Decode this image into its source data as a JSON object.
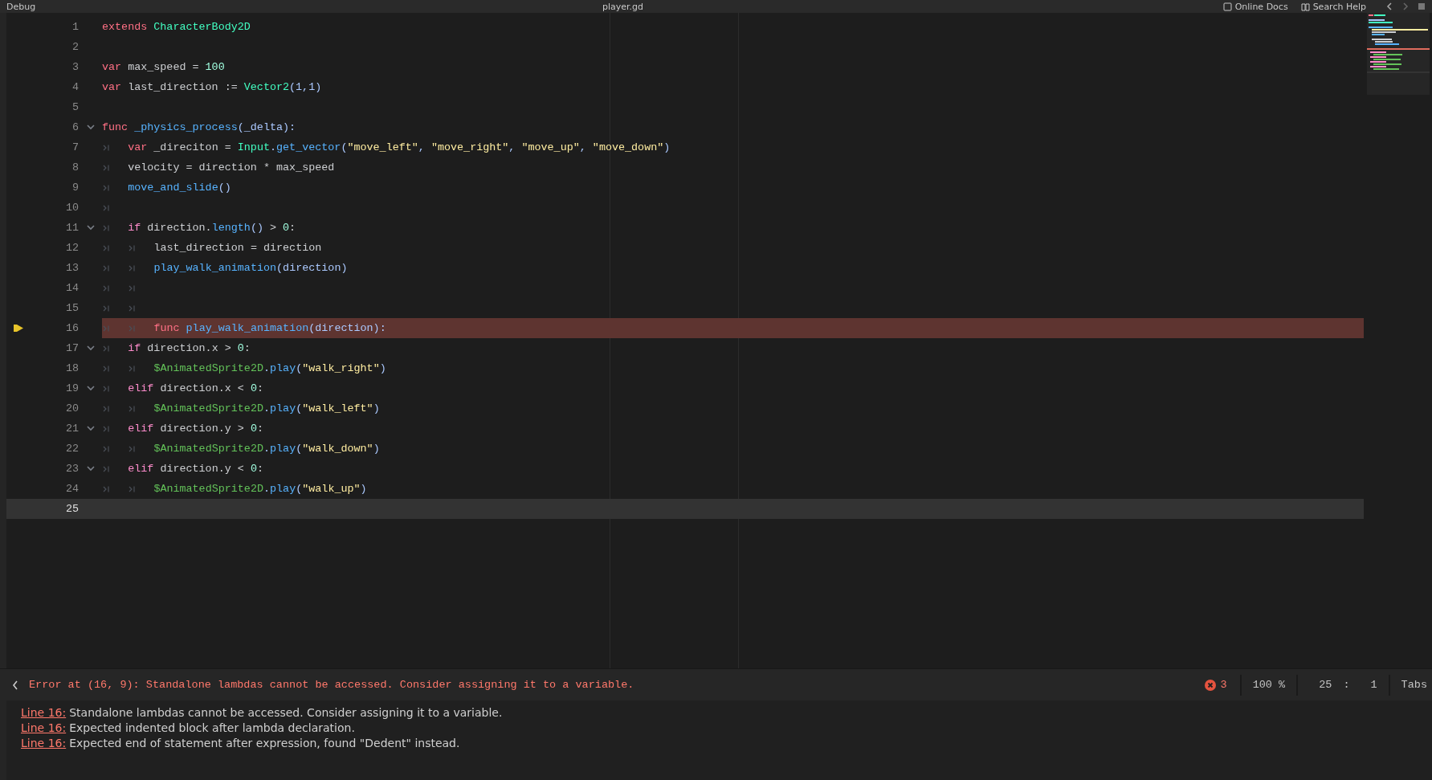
{
  "top_bar": {
    "left": "Debug",
    "title": "player.gd",
    "buttons": [
      {
        "kind": "docs",
        "label": "Online Docs"
      },
      {
        "kind": "help",
        "label": "Search Help"
      }
    ]
  },
  "editor": {
    "lines": [
      {
        "number": "1",
        "fold": false,
        "error": false,
        "current": false,
        "tokens": [
          {
            "kind": "kw",
            "text": "extends"
          },
          {
            "kind": "type",
            "text": "CharacterBody2D"
          }
        ]
      },
      {
        "number": "2",
        "fold": false,
        "error": false,
        "current": false
      },
      {
        "number": "3",
        "fold": false,
        "error": false,
        "current": false,
        "tokens": [
          {
            "kind": "kw",
            "text": "var"
          },
          {
            "kind": "text",
            "text": "max_speed = "
          },
          {
            "kind": "num",
            "text": "100"
          }
        ]
      },
      {
        "number": "4",
        "fold": false,
        "error": false,
        "current": false,
        "tokens": [
          {
            "kind": "kw",
            "text": "var"
          },
          {
            "kind": "text",
            "text": "last_direction := "
          },
          {
            "kind": "type",
            "text": "Vector2"
          },
          {
            "kind": "sym",
            "text": "(1,1)"
          }
        ]
      },
      {
        "number": "5",
        "fold": false,
        "error": false,
        "current": false
      },
      {
        "number": "6",
        "fold": true,
        "error": false,
        "current": false,
        "tokens": [
          {
            "kind": "kw",
            "text": "func"
          },
          {
            "kind": "func",
            "text": "_physics_process"
          },
          {
            "kind": "sym",
            "text": "(_delta):"
          }
        ]
      },
      {
        "number": "7",
        "fold": false,
        "error": false,
        "current": false,
        "tokens": [
          {
            "kind": "tab"
          },
          {
            "kind": "kw",
            "text": "var"
          },
          {
            "kind": "text",
            "text": "_direciton = "
          },
          {
            "kind": "type",
            "text": "Input"
          },
          {
            "kind": "sym",
            "text": "."
          },
          {
            "kind": "func",
            "text": "get_vector"
          },
          {
            "kind": "sym",
            "text": "("
          },
          {
            "kind": "str",
            "text": "\"move_left\""
          },
          {
            "kind": "sym",
            "text": ", "
          },
          {
            "kind": "str",
            "text": "\"move_right\""
          },
          {
            "kind": "sym",
            "text": ", "
          },
          {
            "kind": "str",
            "text": "\"move_up\""
          },
          {
            "kind": "sym",
            "text": ", "
          },
          {
            "kind": "str",
            "text": "\"move_down\""
          },
          {
            "kind": "sym",
            "text": ")"
          }
        ]
      },
      {
        "number": "8",
        "fold": false,
        "error": false,
        "current": false,
        "tokens": [
          {
            "kind": "tab"
          },
          {
            "kind": "text",
            "text": "velocity = direction * max_speed"
          }
        ]
      },
      {
        "number": "9",
        "fold": false,
        "error": false,
        "current": false,
        "tokens": [
          {
            "kind": "tab"
          },
          {
            "kind": "func",
            "text": "move_and_slide"
          },
          {
            "kind": "sym",
            "text": "()"
          }
        ]
      },
      {
        "number": "10",
        "fold": false,
        "error": false,
        "current": false,
        "tokens": [
          {
            "kind": "tab"
          }
        ]
      },
      {
        "number": "11",
        "fold": true,
        "error": false,
        "current": false,
        "tokens": [
          {
            "kind": "tab"
          },
          {
            "kind": "ctrl",
            "text": "if"
          },
          {
            "kind": "text",
            "text": "direction."
          },
          {
            "kind": "func",
            "text": "length"
          },
          {
            "kind": "sym",
            "text": "()"
          },
          {
            "kind": "text",
            "text": " > "
          },
          {
            "kind": "num",
            "text": "0"
          },
          {
            "kind": "text",
            "text": ":"
          }
        ]
      },
      {
        "number": "12",
        "fold": false,
        "error": false,
        "current": false,
        "tokens": [
          {
            "kind": "tab"
          },
          {
            "kind": "tab"
          },
          {
            "kind": "text",
            "text": "last_direction = direction"
          }
        ]
      },
      {
        "number": "13",
        "fold": false,
        "error": false,
        "current": false,
        "tokens": [
          {
            "kind": "tab"
          },
          {
            "kind": "tab"
          },
          {
            "kind": "func",
            "text": "play_walk_animation"
          },
          {
            "kind": "sym",
            "text": "(direction)"
          }
        ]
      },
      {
        "number": "14",
        "fold": false,
        "error": false,
        "current": false,
        "tokens": [
          {
            "kind": "tab"
          },
          {
            "kind": "tab"
          }
        ]
      },
      {
        "number": "15",
        "fold": false,
        "error": false,
        "current": false,
        "tokens": [
          {
            "kind": "tab"
          },
          {
            "kind": "tab"
          }
        ]
      },
      {
        "number": "16",
        "fold": false,
        "error": true,
        "current": false,
        "tokens": [
          {
            "kind": "tab"
          },
          {
            "kind": "tab"
          },
          {
            "kind": "kw",
            "text": "func"
          },
          {
            "kind": "func",
            "text": "play_walk_animation"
          },
          {
            "kind": "sym",
            "text": "(direction):"
          }
        ]
      },
      {
        "number": "17",
        "fold": true,
        "error": false,
        "current": false,
        "tokens": [
          {
            "kind": "tab"
          },
          {
            "kind": "ctrl",
            "text": "if"
          },
          {
            "kind": "text",
            "text": "direction.x > "
          },
          {
            "kind": "num",
            "text": "0"
          },
          {
            "kind": "text",
            "text": ":"
          }
        ]
      },
      {
        "number": "18",
        "fold": false,
        "error": false,
        "current": false,
        "tokens": [
          {
            "kind": "tab"
          },
          {
            "kind": "tab"
          },
          {
            "kind": "node",
            "text": "$AnimatedSprite2D"
          },
          {
            "kind": "sym",
            "text": "."
          },
          {
            "kind": "func",
            "text": "play"
          },
          {
            "kind": "sym",
            "text": "("
          },
          {
            "kind": "str",
            "text": "\"walk_right\""
          },
          {
            "kind": "sym",
            "text": ")"
          }
        ]
      },
      {
        "number": "19",
        "fold": true,
        "error": false,
        "current": false,
        "tokens": [
          {
            "kind": "tab"
          },
          {
            "kind": "ctrl",
            "text": "elif"
          },
          {
            "kind": "text",
            "text": "direction.x < "
          },
          {
            "kind": "num",
            "text": "0"
          },
          {
            "kind": "text",
            "text": ":"
          }
        ]
      },
      {
        "number": "20",
        "fold": false,
        "error": false,
        "current": false,
        "tokens": [
          {
            "kind": "tab"
          },
          {
            "kind": "tab"
          },
          {
            "kind": "node",
            "text": "$AnimatedSprite2D"
          },
          {
            "kind": "sym",
            "text": "."
          },
          {
            "kind": "func",
            "text": "play"
          },
          {
            "kind": "sym",
            "text": "("
          },
          {
            "kind": "str",
            "text": "\"walk_left\""
          },
          {
            "kind": "sym",
            "text": ")"
          }
        ]
      },
      {
        "number": "21",
        "fold": true,
        "error": false,
        "current": false,
        "tokens": [
          {
            "kind": "tab"
          },
          {
            "kind": "ctrl",
            "text": "elif"
          },
          {
            "kind": "text",
            "text": "direction.y > "
          },
          {
            "kind": "num",
            "text": "0"
          },
          {
            "kind": "text",
            "text": ":"
          }
        ]
      },
      {
        "number": "22",
        "fold": false,
        "error": false,
        "current": false,
        "tokens": [
          {
            "kind": "tab"
          },
          {
            "kind": "tab"
          },
          {
            "kind": "node",
            "text": "$AnimatedSprite2D"
          },
          {
            "kind": "sym",
            "text": "."
          },
          {
            "kind": "func",
            "text": "play"
          },
          {
            "kind": "sym",
            "text": "("
          },
          {
            "kind": "str",
            "text": "\"walk_down\""
          },
          {
            "kind": "sym",
            "text": ")"
          }
        ]
      },
      {
        "number": "23",
        "fold": true,
        "error": false,
        "current": false,
        "tokens": [
          {
            "kind": "tab"
          },
          {
            "kind": "ctrl",
            "text": "elif"
          },
          {
            "kind": "text",
            "text": "direction.y < "
          },
          {
            "kind": "num",
            "text": "0"
          },
          {
            "kind": "text",
            "text": ":"
          }
        ]
      },
      {
        "number": "24",
        "fold": false,
        "error": false,
        "current": false,
        "tokens": [
          {
            "kind": "tab"
          },
          {
            "kind": "tab"
          },
          {
            "kind": "node",
            "text": "$AnimatedSprite2D"
          },
          {
            "kind": "sym",
            "text": "."
          },
          {
            "kind": "func",
            "text": "play"
          },
          {
            "kind": "sym",
            "text": "("
          },
          {
            "kind": "str",
            "text": "\"walk_up\""
          },
          {
            "kind": "sym",
            "text": ")"
          }
        ]
      },
      {
        "number": "25",
        "fold": false,
        "error": false,
        "current": true
      }
    ]
  },
  "status_bar": {
    "message": "Error at (16, 9): Standalone lambdas cannot be accessed. Consider assigning it to a variable.",
    "error_count": "3",
    "zoom": "100 %",
    "line": "25",
    "separator": ":",
    "column": "1",
    "indent": "Tabs"
  },
  "errors": [
    {
      "link": "Line 16:",
      "message": "Standalone lambdas cannot be accessed. Consider assigning it to a variable."
    },
    {
      "link": "Line 16:",
      "message": "Expected indented block after lambda declaration."
    },
    {
      "link": "Line 16:",
      "message": "Expected end of statement after expression, found \"Dedent\" instead."
    }
  ]
}
